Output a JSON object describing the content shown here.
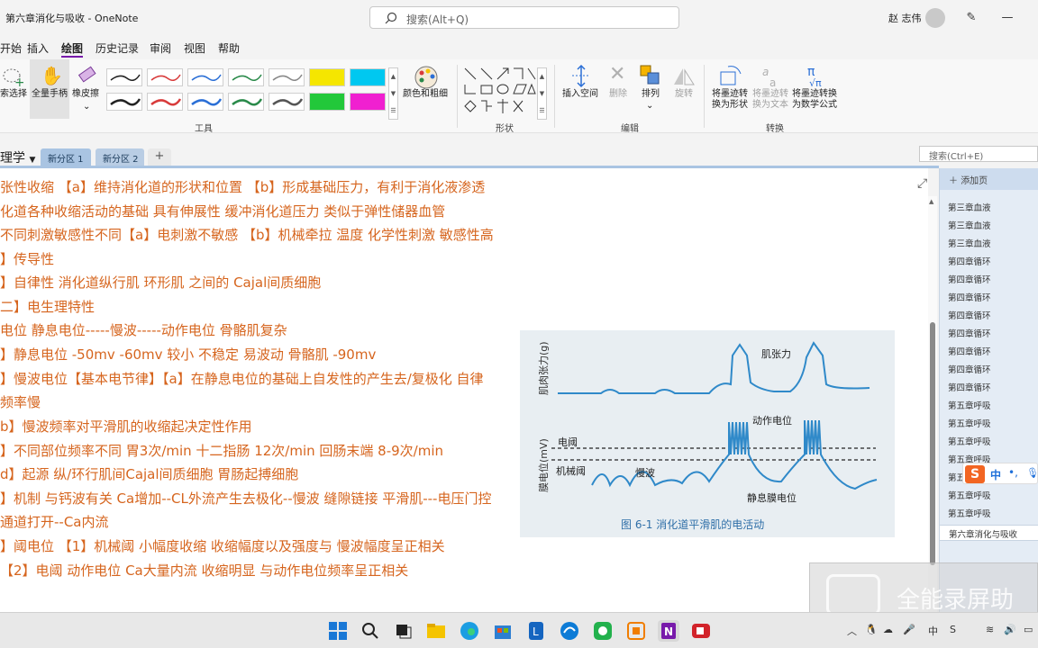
{
  "app": {
    "window_title": "第六章消化与吸收 - OneNote",
    "search_placeholder": "搜索(Alt+Q)",
    "user_name": "赵 志伟"
  },
  "menu": {
    "items": [
      "开始",
      "插入",
      "绘图",
      "历史记录",
      "审阅",
      "视图",
      "帮助"
    ],
    "active": "绘图"
  },
  "ribbon": {
    "lasso_label": "索选择",
    "fullpage_hand_label": "全量手柄",
    "eraser_label": "橡皮擦",
    "color_thickness_label": "颜色和粗细",
    "insert_space_label": "插入空间",
    "delete_label": "删除",
    "arrange_label": "排列",
    "rotate_label": "旋转",
    "ink_to_shape_label1": "将墨迹转",
    "ink_to_shape_label2": "换为形状",
    "ink_to_text_label1": "将墨迹转",
    "ink_to_text_label2": "换为文本",
    "ink_to_math_label1": "将墨迹转换",
    "ink_to_math_label2": "为数学公式",
    "groups": {
      "tools": "工具",
      "shapes": "形状",
      "edit": "编辑",
      "convert": "转换"
    },
    "pen_colors": [
      "#222222",
      "#d83b3b",
      "#2b6fd6",
      "#2a8a4a",
      "#888888",
      "#f5e600",
      "#00c8f0",
      "#222222",
      "#d83b3b",
      "#2b6fd6",
      "#2a8a4a",
      "#555555",
      "#22c83a",
      "#f020d0"
    ]
  },
  "sections": {
    "notebook": "理学",
    "tabs": [
      "新分区 1",
      "新分区 2"
    ],
    "add_tab": "+",
    "page_search_placeholder": "搜索(Ctrl+E)"
  },
  "notes": [
    "张性收缩 【a】维持消化道的形状和位置 【b】形成基础压力，有利于消化液渗透",
    "化道各种收缩活动的基础            具有伸展性 缓冲消化道压力 类似于弹性储器血管",
    "不同刺激敏感性不同【a】电刺激不敏感 【b】机械牵拉 温度  化学性刺激 敏感性高",
    "】传导性",
    "】自律性  消化道纵行肌 环形肌 之间的 Cajal间质细胞",
    "二】电生理特性",
    "电位  静息电位-----慢波-----动作电位 骨骼肌复杂",
    "】静息电位  -50mv   -60mv  较小 不稳定 易波动 骨骼肌 -90mv",
    "】慢波电位【基本电节律】【a】在静息电位的基础上自发性的产生去/复极化 自律",
    "频率慢",
    "b】慢波频率对平滑肌的收缩起决定性作用",
    "】不同部位频率不同  胃3次/min   十二指肠 12次/min    回肠末端 8-9次/min",
    "d】起源 纵/环行肌间Cajal间质细胞 胃肠起搏细胞",
    "】机制 与钙波有关 Ca增加--CL外流产生去极化--慢波 缝隙链接 平滑肌---电压门控",
    "通道打开--Ca内流",
    "】阈电位 【1】机械阈   小幅度收缩 收缩幅度以及强度与  慢波幅度呈正相关",
    "              【2】电阈   动作电位 Ca大量内流 收缩明显  与动作电位频率呈正相关"
  ],
  "figure": {
    "label_tension": "肌张力",
    "label_action_potential": "动作电位",
    "label_electric_threshold": "电阈",
    "label_mechanical_threshold": "机械阈",
    "label_slow_wave": "慢波",
    "label_resting": "静息膜电位",
    "ylabel_top": "肌肉张力(g)",
    "ylabel_bottom": "膜电位(mV)",
    "caption": "图 6-1  消化道平滑肌的电活动"
  },
  "pagelist": {
    "add_page": "添加页",
    "pages": [
      "第三章血液",
      "第三章血液",
      "第三章血液",
      "第四章循环",
      "第四章循环",
      "第四章循环",
      "第四章循环",
      "第四章循环",
      "第四章循环",
      "第四章循环",
      "第四章循环",
      "第五章呼吸",
      "第五章呼吸",
      "第五章呼吸",
      "第五章呼吸",
      "第五章呼吸",
      "第五章呼吸",
      "第五章呼吸"
    ],
    "selected_page": "第六章消化与吸收"
  },
  "ime": {
    "zh": "中",
    "dot": "•,",
    "mic": "🎤"
  },
  "watermark": {
    "text": "全能录屏助"
  }
}
